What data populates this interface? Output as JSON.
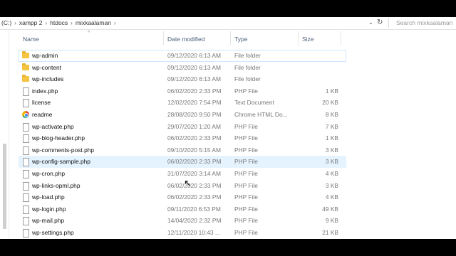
{
  "address_bar": {
    "drive": "(C:)",
    "crumbs": [
      "xampp 2",
      "htdocs",
      "mixkaalaman"
    ],
    "search_placeholder": "Search mixkaalaman"
  },
  "columns": {
    "name": "Name",
    "date": "Date modified",
    "type": "Type",
    "size": "Size"
  },
  "files": [
    {
      "name": "wp-admin",
      "date": "09/12/2020 6:13 AM",
      "type": "File folder",
      "size": "",
      "icon": "folder-icon"
    },
    {
      "name": "wp-content",
      "date": "09/12/2020 6:13 AM",
      "type": "File folder",
      "size": "",
      "icon": "folder-icon"
    },
    {
      "name": "wp-includes",
      "date": "09/12/2020 6:13 AM",
      "type": "File folder",
      "size": "",
      "icon": "folder-icon"
    },
    {
      "name": "index.php",
      "date": "06/02/2020 2:33 PM",
      "type": "PHP File",
      "size": "1 KB",
      "icon": "php-file-icon"
    },
    {
      "name": "license",
      "date": "12/02/2020 7:54 PM",
      "type": "Text Document",
      "size": "20 KB",
      "icon": "text-file-icon"
    },
    {
      "name": "readme",
      "date": "28/08/2020 9:50 PM",
      "type": "Chrome HTML Do...",
      "size": "8 KB",
      "icon": "chrome-icon"
    },
    {
      "name": "wp-activate.php",
      "date": "29/07/2020 1:20 AM",
      "type": "PHP File",
      "size": "7 KB",
      "icon": "php-file-icon"
    },
    {
      "name": "wp-blog-header.php",
      "date": "06/02/2020 2:33 PM",
      "type": "PHP File",
      "size": "1 KB",
      "icon": "php-file-icon"
    },
    {
      "name": "wp-comments-post.php",
      "date": "09/10/2020 5:15 AM",
      "type": "PHP File",
      "size": "3 KB",
      "icon": "php-file-icon"
    },
    {
      "name": "wp-config-sample.php",
      "date": "06/02/2020 2:33 PM",
      "type": "PHP File",
      "size": "3 KB",
      "icon": "php-file-icon"
    },
    {
      "name": "wp-cron.php",
      "date": "31/07/2020 3:14 AM",
      "type": "PHP File",
      "size": "4 KB",
      "icon": "php-file-icon"
    },
    {
      "name": "wp-links-opml.php",
      "date": "06/02/2020 2:33 PM",
      "type": "PHP File",
      "size": "3 KB",
      "icon": "php-file-icon"
    },
    {
      "name": "wp-load.php",
      "date": "06/02/2020 2:33 PM",
      "type": "PHP File",
      "size": "4 KB",
      "icon": "php-file-icon"
    },
    {
      "name": "wp-login.php",
      "date": "09/11/2020 6:53 PM",
      "type": "PHP File",
      "size": "49 KB",
      "icon": "php-file-icon"
    },
    {
      "name": "wp-mail.php",
      "date": "14/04/2020 2:32 PM",
      "type": "PHP File",
      "size": "9 KB",
      "icon": "php-file-icon"
    },
    {
      "name": "wp-settings.php",
      "date": "12/11/2020 10:43 ...",
      "type": "PHP File",
      "size": "21 KB",
      "icon": "php-file-icon"
    }
  ],
  "selected_row": 9,
  "focused_row": 0
}
